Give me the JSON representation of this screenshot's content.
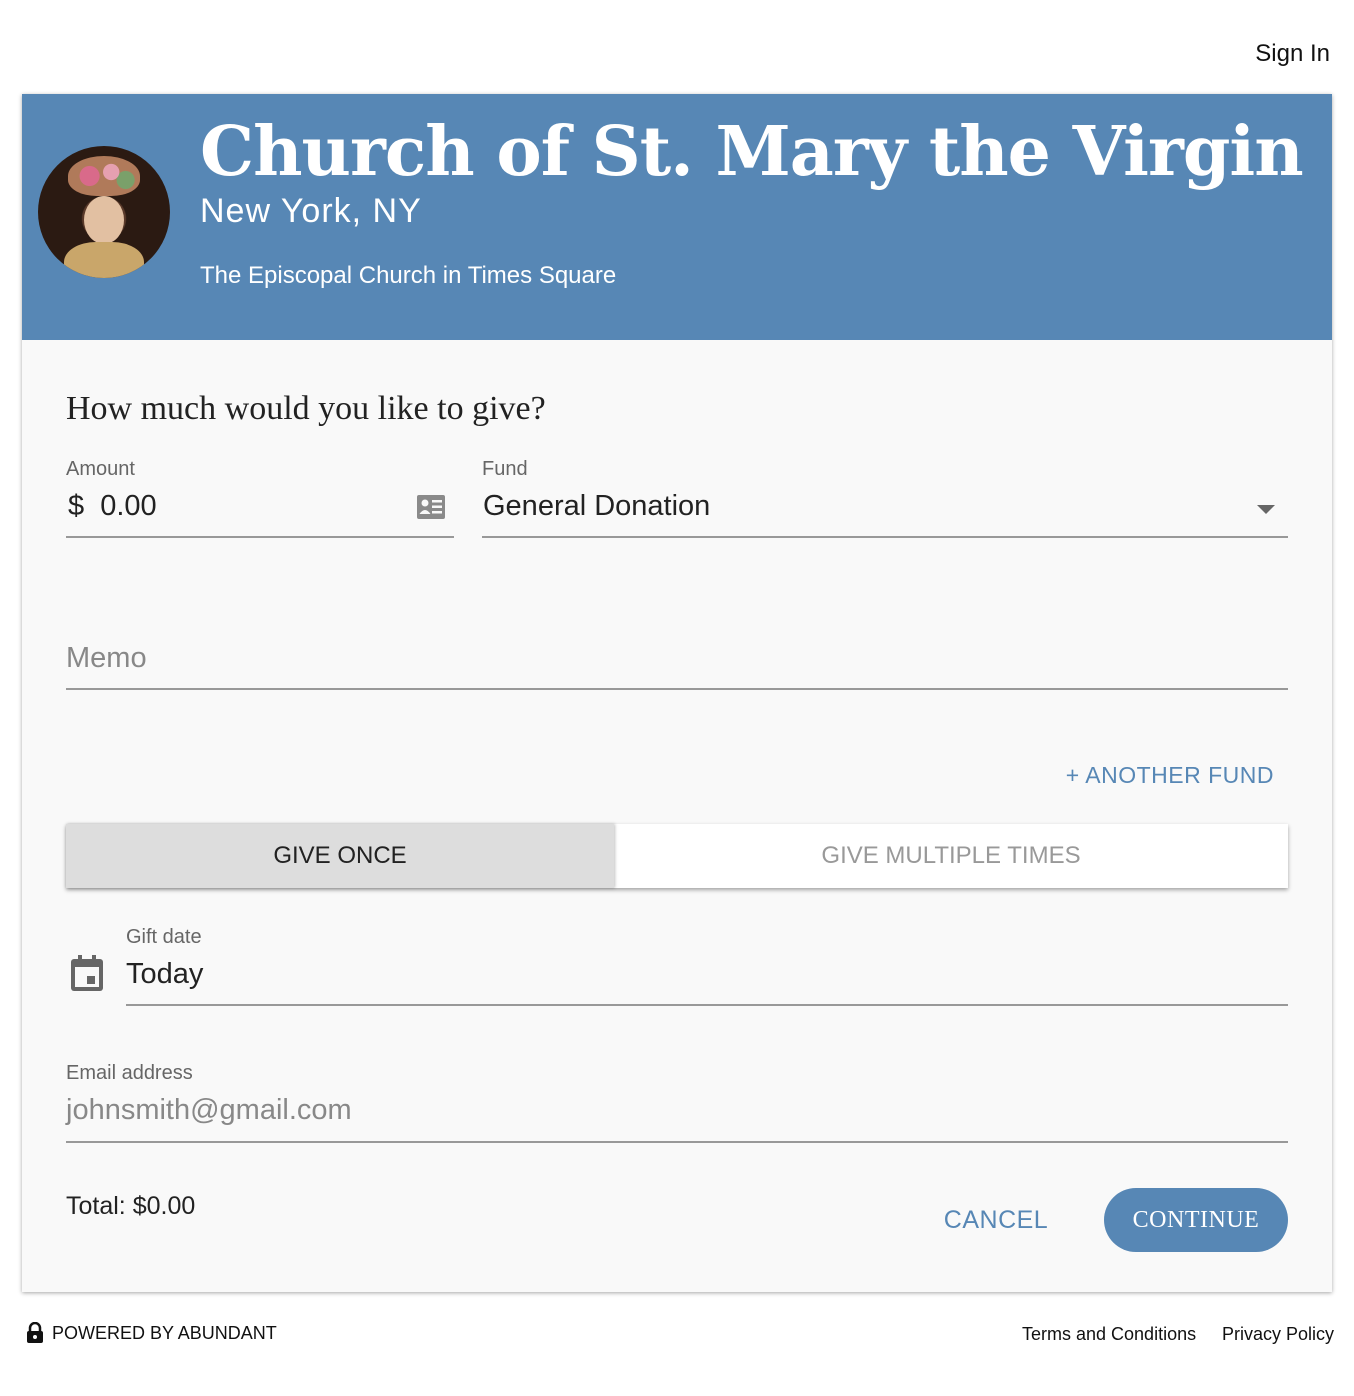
{
  "topbar": {
    "sign_in_label": "Sign In"
  },
  "header": {
    "church_name": "Church of St. Mary the Virgin",
    "location": "New York, NY",
    "tagline": "The Episcopal Church in Times Square",
    "background_color": "#5787b5"
  },
  "form": {
    "question": "How much would you like to give?",
    "amount": {
      "label": "Amount",
      "currency_symbol": "$",
      "value": "0.00",
      "icon": "contact-card-icon"
    },
    "fund": {
      "label": "Fund",
      "value": "General Donation",
      "icon": "dropdown-arrow-icon"
    },
    "memo": {
      "placeholder": "Memo"
    },
    "another_fund_label": "+ ANOTHER FUND",
    "frequency": {
      "options": [
        "GIVE ONCE",
        "GIVE MULTIPLE TIMES"
      ],
      "selected": "GIVE ONCE"
    },
    "gift_date": {
      "label": "Gift date",
      "value": "Today",
      "icon": "calendar-icon"
    },
    "email": {
      "label": "Email address",
      "placeholder": "johnsmith@gmail.com"
    },
    "total_text": "Total: $0.00",
    "cancel_label": "CANCEL",
    "continue_label": "CONTINUE"
  },
  "footer": {
    "powered_by": "POWERED BY ABUNDANT",
    "lock_icon": "lock-icon",
    "terms_label": "Terms and Conditions",
    "privacy_label": "Privacy Policy"
  },
  "colors": {
    "accent": "#5787b5",
    "card_background": "#f9f9f9",
    "toggle_selected": "#dddddd"
  }
}
